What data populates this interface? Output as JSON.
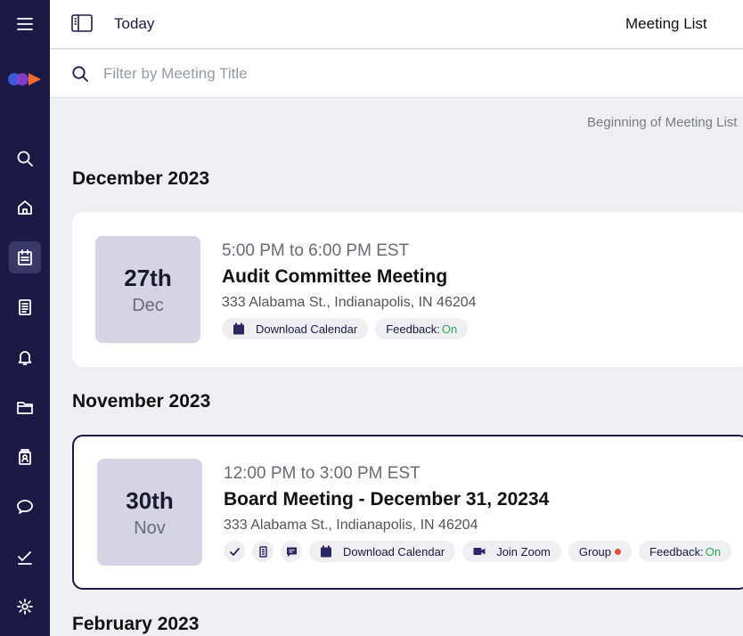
{
  "topbar": {
    "today_label": "Today",
    "title": "Meeting List"
  },
  "search": {
    "placeholder": "Filter by Meeting Title",
    "value": ""
  },
  "list": {
    "beginning_label": "Beginning of Meeting List"
  },
  "sections": [
    {
      "month": "December 2023",
      "meetings": [
        {
          "day": "27th",
          "mon": "Dec",
          "time": "5:00 PM to 6:00 PM EST",
          "title": "Audit Committee Meeting",
          "address": "333 Alabama St., Indianapolis, IN 46204",
          "download_label": "Download Calendar",
          "feedback_label": "Feedback:",
          "feedback_value": "On"
        }
      ]
    },
    {
      "month": "November 2023",
      "meetings": [
        {
          "day": "30th",
          "mon": "Nov",
          "time": "12:00 PM to 3:00 PM EST",
          "title": "Board Meeting - December 31, 20234",
          "address": "333 Alabama St., Indianapolis, IN 46204",
          "download_label": "Download Calendar",
          "zoom_label": "Join Zoom",
          "group_label": "Group",
          "feedback_label": "Feedback:",
          "feedback_value": "On"
        }
      ]
    },
    {
      "month": "February 2023"
    }
  ],
  "sidebar": {
    "items": [
      "menu-icon",
      "search-icon",
      "home-icon",
      "calendar-icon",
      "document-icon",
      "bell-icon",
      "folder-icon",
      "directory-icon",
      "chat-icon",
      "tasks-icon",
      "gear-icon"
    ],
    "active": "calendar-icon"
  },
  "colors": {
    "sidebar": "#1c1a44",
    "accent": "#1c1a44",
    "feedback_on": "#2aa84a",
    "group_dot": "#e0503a",
    "date_box": "#d6d4e4"
  }
}
